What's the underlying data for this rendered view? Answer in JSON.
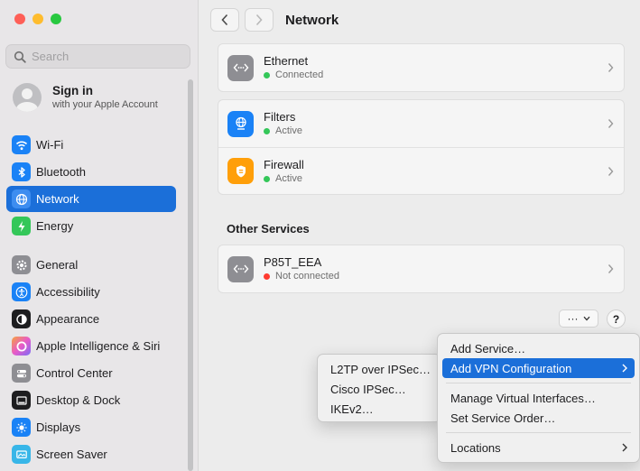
{
  "sidebar": {
    "search_placeholder": "Search",
    "account": {
      "title": "Sign in",
      "subtitle": "with your Apple Account"
    },
    "items": [
      {
        "label": "Wi-Fi",
        "icon": "wifi-icon",
        "color": "#1a82f6"
      },
      {
        "label": "Bluetooth",
        "icon": "bluetooth-icon",
        "color": "#1a82f6"
      },
      {
        "label": "Network",
        "icon": "globe-icon",
        "color": "#1a82f6",
        "active": true
      },
      {
        "label": "Energy",
        "icon": "bolt-icon",
        "color": "#34c759"
      },
      {
        "label": "General",
        "icon": "gear-icon",
        "color": "#8e8e93"
      },
      {
        "label": "Accessibility",
        "icon": "accessibility-icon",
        "color": "#1a82f6"
      },
      {
        "label": "Appearance",
        "icon": "appearance-icon",
        "color": "#1d1d1f"
      },
      {
        "label": "Apple Intelligence & Siri",
        "icon": "siri-icon",
        "color": "#e85ac8"
      },
      {
        "label": "Control Center",
        "icon": "toggles-icon",
        "color": "#8e8e93"
      },
      {
        "label": "Desktop & Dock",
        "icon": "dock-icon",
        "color": "#1d1d1f"
      },
      {
        "label": "Displays",
        "icon": "sun-icon",
        "color": "#1a82f6"
      },
      {
        "label": "Screen Saver",
        "icon": "screensaver-icon",
        "color": "#38b6e8"
      }
    ]
  },
  "header": {
    "title": "Network"
  },
  "services": [
    {
      "name": "Ethernet",
      "status": "Connected",
      "status_color": "#34c759",
      "icon": "ethernet-icon"
    },
    {
      "name": "Filters",
      "status": "Active",
      "status_color": "#34c759",
      "icon": "filter-globe-icon"
    },
    {
      "name": "Firewall",
      "status": "Active",
      "status_color": "#34c759",
      "icon": "shield-icon"
    }
  ],
  "other_services_title": "Other Services",
  "other_services": [
    {
      "name": "P85T_EEA",
      "status": "Not connected",
      "status_color": "#ff3b30",
      "icon": "ethernet-icon"
    }
  ],
  "more_button": {
    "label": "···"
  },
  "help_button": {
    "label": "?"
  },
  "actions_menu": {
    "add_service": "Add Service…",
    "add_vpn": "Add VPN Configuration",
    "manage_virtual": "Manage Virtual Interfaces…",
    "set_order": "Set Service Order…",
    "locations": "Locations"
  },
  "vpn_submenu": {
    "l2tp": "L2TP over IPSec…",
    "cisco": "Cisco IPSec…",
    "ikev2": "IKEv2…"
  }
}
